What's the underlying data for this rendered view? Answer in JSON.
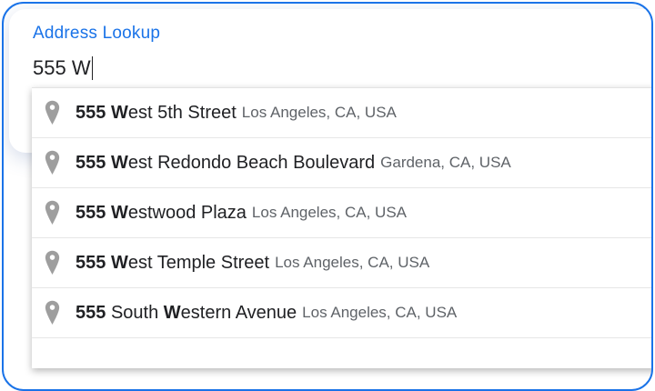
{
  "field": {
    "label": "Address Lookup",
    "value": "555 W"
  },
  "suggestions": [
    {
      "number": "555",
      "plain_before": "",
      "match": "W",
      "rest": "est 5th Street",
      "secondary": "Los Angeles, CA, USA"
    },
    {
      "number": "555",
      "plain_before": "",
      "match": "W",
      "rest": "est Redondo Beach Boulevard",
      "secondary": "Gardena, CA, USA"
    },
    {
      "number": "555",
      "plain_before": "",
      "match": "W",
      "rest": "estwood Plaza",
      "secondary": "Los Angeles, CA, USA"
    },
    {
      "number": "555",
      "plain_before": "",
      "match": "W",
      "rest": "est Temple Street",
      "secondary": "Los Angeles, CA, USA"
    },
    {
      "number": "555",
      "plain_before": "South ",
      "match": "W",
      "rest": "estern Avenue",
      "secondary": "Los Angeles, CA, USA"
    }
  ],
  "icons": {
    "suggestion_icon": "map-pin-icon"
  },
  "colors": {
    "accent": "#1a73e8",
    "pin": "#9e9e9e",
    "secondary_text": "#5f6368"
  }
}
